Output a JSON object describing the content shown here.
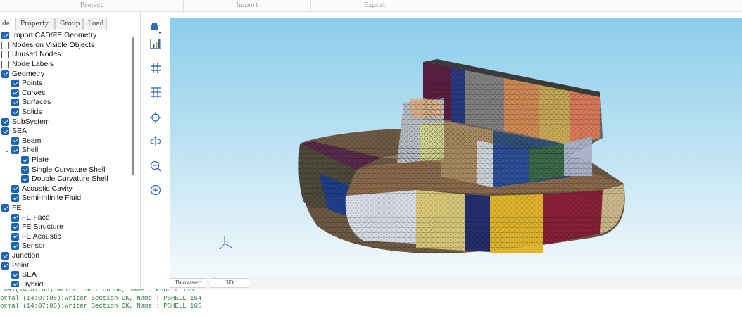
{
  "ribbon": {
    "groups": [
      "Project",
      "Import",
      "Export"
    ]
  },
  "left_panel": {
    "tabs": [
      "del",
      "Property",
      "Group",
      "Load"
    ],
    "active_tab": "del",
    "tree": [
      {
        "label": "Import CAD/FE Geometry",
        "checked": true,
        "level": 0,
        "expander": ""
      },
      {
        "label": "Nodes on Visible Objects",
        "checked": false,
        "level": 0,
        "expander": ""
      },
      {
        "label": "Unused Nodes",
        "checked": false,
        "level": 0,
        "expander": ""
      },
      {
        "label": "Node Labels",
        "checked": false,
        "level": 0,
        "expander": ""
      },
      {
        "label": "Geometry",
        "checked": true,
        "level": 0,
        "expander": ""
      },
      {
        "label": "Points",
        "checked": true,
        "level": 1,
        "expander": ""
      },
      {
        "label": "Curves",
        "checked": true,
        "level": 1,
        "expander": ""
      },
      {
        "label": "Surfaces",
        "checked": true,
        "level": 1,
        "expander": ""
      },
      {
        "label": "Solids",
        "checked": true,
        "level": 1,
        "expander": ""
      },
      {
        "label": "SubSystem",
        "checked": true,
        "level": 0,
        "expander": ""
      },
      {
        "label": "SEA",
        "checked": true,
        "level": 0,
        "expander": "collapse"
      },
      {
        "label": "Beam",
        "checked": true,
        "level": 1,
        "expander": ""
      },
      {
        "label": "Shell",
        "checked": true,
        "level": 1,
        "expander": "collapse"
      },
      {
        "label": "Plate",
        "checked": true,
        "level": 2,
        "expander": ""
      },
      {
        "label": "Single Curvature Shell",
        "checked": true,
        "level": 2,
        "expander": ""
      },
      {
        "label": "Double Curvature Shell",
        "checked": true,
        "level": 2,
        "expander": ""
      },
      {
        "label": "Acoustic Cavity",
        "checked": true,
        "level": 1,
        "expander": ""
      },
      {
        "label": "Semi-Infinite Fluid",
        "checked": true,
        "level": 1,
        "expander": ""
      },
      {
        "label": "FE",
        "checked": true,
        "level": 0,
        "expander": "collapse"
      },
      {
        "label": "FE Face",
        "checked": true,
        "level": 1,
        "expander": ""
      },
      {
        "label": "FE Structure",
        "checked": true,
        "level": 1,
        "expander": ""
      },
      {
        "label": "FE Acoustic",
        "checked": true,
        "level": 1,
        "expander": ""
      },
      {
        "label": "Sensor",
        "checked": true,
        "level": 1,
        "expander": ""
      },
      {
        "label": "Junction",
        "checked": true,
        "level": 0,
        "expander": ""
      },
      {
        "label": "Point",
        "checked": true,
        "level": 0,
        "expander": "collapse"
      },
      {
        "label": "SEA",
        "checked": true,
        "level": 1,
        "expander": ""
      },
      {
        "label": "Hybrid",
        "checked": true,
        "level": 1,
        "expander": ""
      }
    ]
  },
  "toolbar": {
    "icons": [
      "cube-dropdown-icon",
      "chart-icon",
      "grid-icon",
      "grid-split-icon",
      "move-icon",
      "rotate-icon",
      "zoom-out-icon",
      "zoom-in-icon"
    ]
  },
  "viewport": {
    "tabs": [
      "Browser",
      "3D"
    ],
    "active_tab": "3D",
    "background_top": "#8ccdeb",
    "background_bottom": "#f4f9fc"
  },
  "log": {
    "lines": [
      "rmal(14:07:05):Writer Section OK, Name : PSHELL 163",
      "ormal (14:07:05):Writer Section OK, Name : PSHELL 164",
      "ormal (14:07:05):Writer Section OK, Name : PSHELL 165"
    ]
  },
  "colors": {
    "checkbox": "#1d63b8",
    "log_text": "#2f7d3f"
  }
}
